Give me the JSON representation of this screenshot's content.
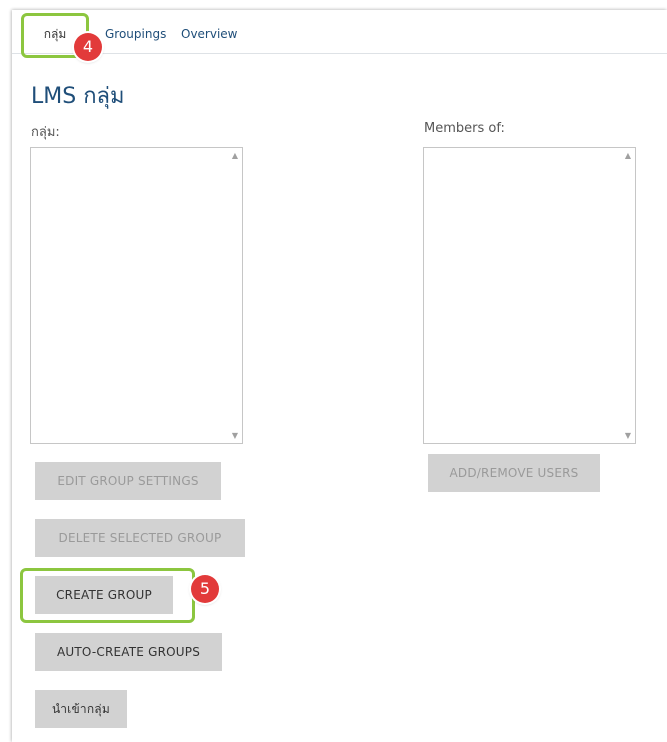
{
  "tabs": [
    {
      "label": "กลุ่ม",
      "active": true
    },
    {
      "label": "Groupings",
      "active": false
    },
    {
      "label": "Overview",
      "active": false
    }
  ],
  "callouts": {
    "tab_step": "4",
    "create_step": "5"
  },
  "page": {
    "title": "LMS กลุ่ม"
  },
  "groups_panel": {
    "label": "กลุ่ม:",
    "items": []
  },
  "members_panel": {
    "label": "Members of:",
    "items": []
  },
  "buttons": {
    "edit": "EDIT GROUP SETTINGS",
    "delete": "DELETE SELECTED GROUP",
    "create": "CREATE GROUP",
    "auto_create": "AUTO-CREATE GROUPS",
    "import": "นำเข้ากลุ่ม",
    "add_remove": "ADD/REMOVE USERS"
  },
  "icons": {
    "scroll_up": "▲",
    "scroll_down": "▼"
  },
  "colors": {
    "title": "#1f4e79",
    "callout_border": "#8cc63f",
    "badge": "#e23a3a",
    "button_bg": "#d2d2d2"
  }
}
